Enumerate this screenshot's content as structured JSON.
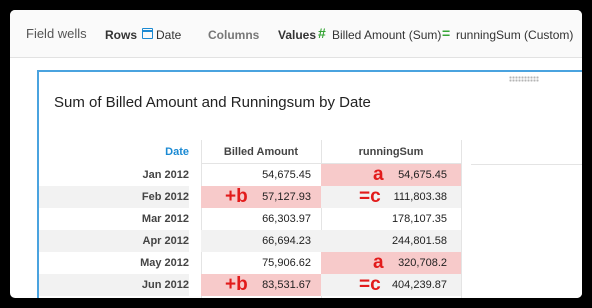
{
  "field_wells": {
    "title": "Field wells",
    "rows_label": "Rows",
    "rows_field": "Date",
    "columns_label": "Columns",
    "values_label": "Values",
    "value_fields": [
      "Billed Amount (Sum)",
      "runningSum (Custom)"
    ]
  },
  "visual": {
    "title": "Sum of Billed Amount and Runningsum by Date",
    "columns": [
      "Date",
      "Billed Amount",
      "runningSum"
    ],
    "rows": [
      {
        "date": "Jan 2012",
        "billed": "54,675.45",
        "running": "54,675.45"
      },
      {
        "date": "Feb 2012",
        "billed": "57,127.93",
        "running": "111,803.38"
      },
      {
        "date": "Mar 2012",
        "billed": "66,303.97",
        "running": "178,107.35"
      },
      {
        "date": "Apr 2012",
        "billed": "66,694.23",
        "running": "244,801.58"
      },
      {
        "date": "May 2012",
        "billed": "75,906.62",
        "running": "320,708.2"
      },
      {
        "date": "Jun 2012",
        "billed": "83,531.67",
        "running": "404,239.87"
      }
    ]
  },
  "annotations": {
    "a": "a",
    "b": "+b",
    "c": "=c"
  },
  "colors": {
    "accent": "#1b8ad3",
    "green": "#35a435",
    "highlight": "#f7caca",
    "annotation": "#e21b1b"
  }
}
